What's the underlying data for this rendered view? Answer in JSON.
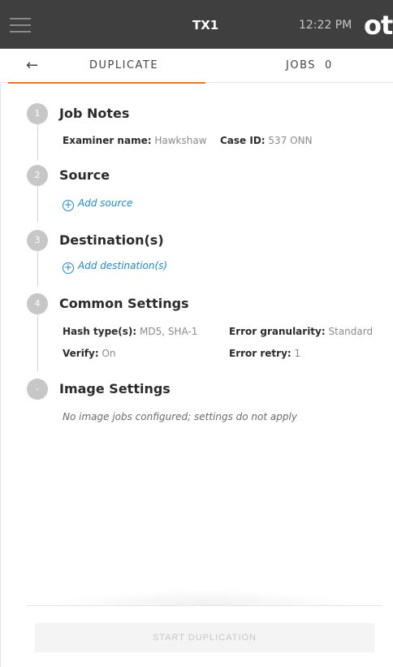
{
  "header": {
    "device_name": "TX1",
    "time": "12:22 PM",
    "logo_text": "ot",
    "menu_icon": "hamburger-icon"
  },
  "tabs": {
    "back_icon": "arrow-left-icon",
    "duplicate_label": "DUPLICATE",
    "jobs_label": "JOBS",
    "jobs_count": "0",
    "active_color": "#f07622"
  },
  "steps": {
    "job_notes": {
      "number": "1",
      "title": "Job Notes",
      "examiner_key": "Examiner name:",
      "examiner_value": "Hawkshaw",
      "case_key": "Case ID:",
      "case_value": "537 ONN"
    },
    "source": {
      "number": "2",
      "title": "Source",
      "add_label": "Add source"
    },
    "destination": {
      "number": "3",
      "title": "Destination(s)",
      "add_label": "Add destination(s)"
    },
    "common": {
      "number": "4",
      "title": "Common Settings",
      "hash_key": "Hash type(s):",
      "hash_value": "MD5, SHA-1",
      "granularity_key": "Error granularity:",
      "granularity_value": "Standard",
      "verify_key": "Verify:",
      "verify_value": "On",
      "retry_key": "Error retry:",
      "retry_value": "1"
    },
    "image": {
      "number": "-",
      "title": "Image Settings",
      "note": "No image jobs configured; settings do not apply"
    }
  },
  "footer": {
    "start_label": "START DUPLICATION"
  },
  "colors": {
    "topbar": "#3f3f3f",
    "link": "#1e88c7",
    "step_circle": "#c7c7c7"
  }
}
